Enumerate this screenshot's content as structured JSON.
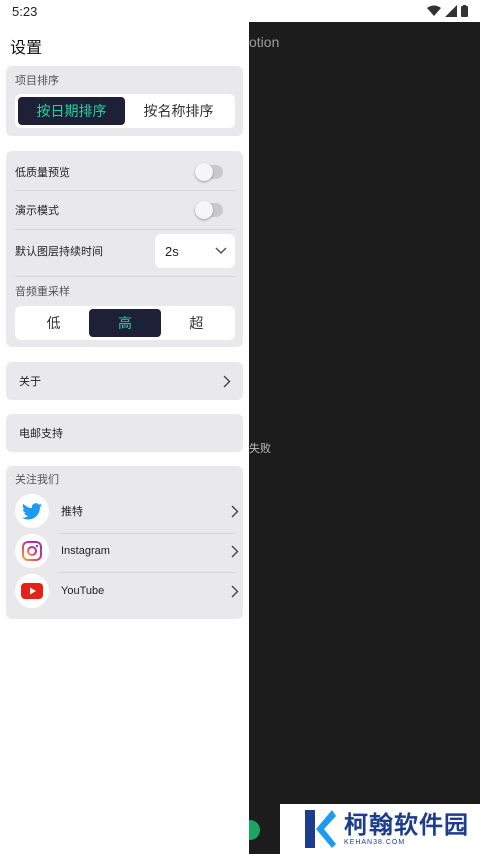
{
  "status_bar": {
    "time": "5:23"
  },
  "background": {
    "logo_fragment": "otion",
    "text_fragment": "失败"
  },
  "drawer": {
    "title": "设置",
    "sort": {
      "label": "项目排序",
      "options": [
        "按日期排序",
        "按名称排序"
      ],
      "selected": "按日期排序"
    },
    "settings": {
      "low_quality_preview": {
        "label": "低质量预览",
        "on": false
      },
      "demo_mode": {
        "label": "演示模式",
        "on": false
      },
      "default_layer_duration": {
        "label": "默认图层持续时间",
        "value": "2s"
      },
      "audio_resample": {
        "label": "音频重采样",
        "options": [
          "低",
          "高",
          "超"
        ],
        "selected": "高"
      }
    },
    "about": {
      "label": "关于"
    },
    "email": {
      "label": "电邮支持"
    },
    "follow": {
      "label": "关注我们",
      "items": [
        {
          "label": "推特",
          "icon": "twitter-icon"
        },
        {
          "label": "Instagram",
          "icon": "instagram-icon"
        },
        {
          "label": "YouTube",
          "icon": "youtube-icon"
        }
      ]
    }
  },
  "watermark": {
    "cn": "柯翰软件园",
    "en": "KEHAN38.COM"
  },
  "colors": {
    "accent_green": "#22d3a1",
    "segment_active_bg": "#1d2036",
    "card_bg": "#e9e9ec",
    "twitter_blue": "#1d9bf0",
    "youtube_red": "#e62117"
  }
}
